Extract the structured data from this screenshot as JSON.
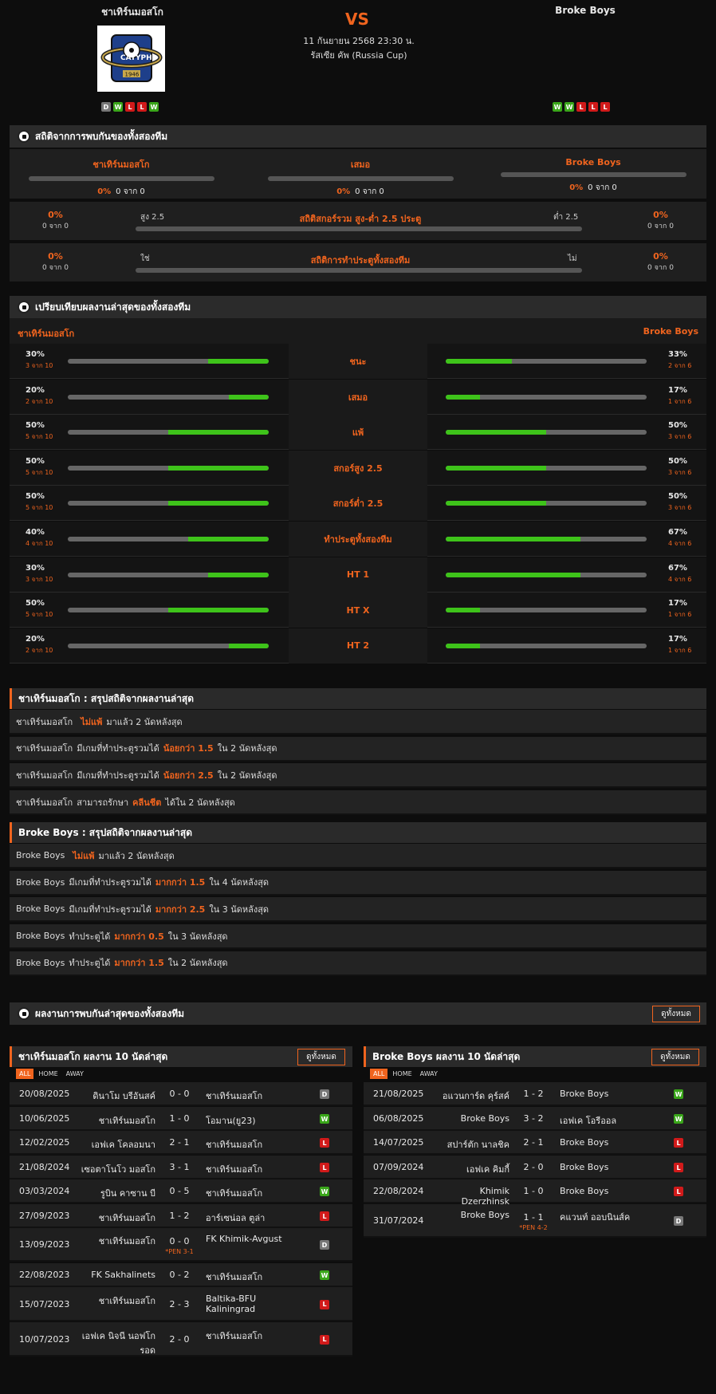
{
  "match": {
    "home": "ชาเทิร์นมอสโก",
    "away": "Broke Boys",
    "vs": "VS",
    "datetime": "11 กันยายน 2568 23:30 น.",
    "competition": "รัสเซีย คัพ (Russia Cup)",
    "logo_year": "1946",
    "home_form": [
      "D",
      "W",
      "L",
      "L",
      "W"
    ],
    "away_form": [
      "W",
      "W",
      "L",
      "L",
      "L"
    ]
  },
  "h2h": {
    "title": "สถิติจากการพบกันของทั้งสองทีม",
    "cols": [
      {
        "name": "ชาเทิร์นมอสโก",
        "pct": "0%",
        "sub": "0 จาก 0"
      },
      {
        "name": "เสมอ",
        "pct": "0%",
        "sub": "0 จาก 0"
      },
      {
        "name": "Broke Boys",
        "pct": "0%",
        "sub": "0 จาก 0"
      }
    ],
    "ou": {
      "left_pct": "0%",
      "left_sub": "0 จาก 0",
      "left_lbl": "สูง 2.5",
      "title": "สถิติสกอร์รวม สูง-ต่ำ 2.5 ประตู",
      "right_lbl": "ต่ำ 2.5",
      "right_pct": "0%",
      "right_sub": "0 จาก 0"
    },
    "btts": {
      "left_pct": "0%",
      "left_sub": "0 จาก 0",
      "left_lbl": "ใช่",
      "title": "สถิติการทำประตูทั้งสองทีม",
      "right_lbl": "ไม่",
      "right_pct": "0%",
      "right_sub": "0 จาก 0"
    }
  },
  "compare": {
    "title": "เปรียบเทียบผลงานล่าสุดของทั้งสองทีม",
    "home": "ชาเทิร์นมอสโก",
    "away": "Broke Boys",
    "rows": [
      {
        "label": "ชนะ",
        "lp": "30%",
        "ls": "3 จาก 10",
        "lv": 0.3,
        "rp": "33%",
        "rs": "2 จาก 6",
        "rv": 0.33
      },
      {
        "label": "เสมอ",
        "lp": "20%",
        "ls": "2 จาก 10",
        "lv": 0.2,
        "rp": "17%",
        "rs": "1 จาก 6",
        "rv": 0.17
      },
      {
        "label": "แพ้",
        "lp": "50%",
        "ls": "5 จาก 10",
        "lv": 0.5,
        "rp": "50%",
        "rs": "3 จาก 6",
        "rv": 0.5
      },
      {
        "label": "สกอร์สูง 2.5",
        "lp": "50%",
        "ls": "5 จาก 10",
        "lv": 0.5,
        "rp": "50%",
        "rs": "3 จาก 6",
        "rv": 0.5
      },
      {
        "label": "สกอร์ต่ำ 2.5",
        "lp": "50%",
        "ls": "5 จาก 10",
        "lv": 0.5,
        "rp": "50%",
        "rs": "3 จาก 6",
        "rv": 0.5
      },
      {
        "label": "ทำประตูทั้งสองทีม",
        "lp": "40%",
        "ls": "4 จาก 10",
        "lv": 0.4,
        "rp": "67%",
        "rs": "4 จาก 6",
        "rv": 0.67
      },
      {
        "label": "HT 1",
        "lp": "30%",
        "ls": "3 จาก 10",
        "lv": 0.3,
        "rp": "67%",
        "rs": "4 จาก 6",
        "rv": 0.67
      },
      {
        "label": "HT X",
        "lp": "50%",
        "ls": "5 จาก 10",
        "lv": 0.5,
        "rp": "17%",
        "rs": "1 จาก 6",
        "rv": 0.17
      },
      {
        "label": "HT 2",
        "lp": "20%",
        "ls": "2 จาก 10",
        "lv": 0.2,
        "rp": "17%",
        "rs": "1 จาก 6",
        "rv": 0.17
      }
    ]
  },
  "summary_home": {
    "title": "ชาเทิร์นมอสโก : สรุปสถิติจากผลงานล่าสุด",
    "rows": [
      {
        "team": "ชาเทิร์นมอสโก",
        "pre": "",
        "hl": "ไม่แพ้",
        "post": "มาแล้ว 2 นัดหลังสุด"
      },
      {
        "team": "ชาเทิร์นมอสโก",
        "pre": "มีเกมที่ทำประตูรวมได้",
        "hl": "น้อยกว่า 1.5",
        "post": "ใน 2 นัดหลังสุด"
      },
      {
        "team": "ชาเทิร์นมอสโก",
        "pre": "มีเกมที่ทำประตูรวมได้",
        "hl": "น้อยกว่า 2.5",
        "post": "ใน 2 นัดหลังสุด"
      },
      {
        "team": "ชาเทิร์นมอสโก",
        "pre": "สามารถรักษา",
        "hl": "คลีนชีต",
        "post": "ได้ใน 2 นัดหลังสุด"
      }
    ]
  },
  "summary_away": {
    "title": "Broke Boys : สรุปสถิติจากผลงานล่าสุด",
    "rows": [
      {
        "team": "Broke Boys",
        "pre": "",
        "hl": "ไม่แพ้",
        "post": "มาแล้ว 2 นัดหลังสุด"
      },
      {
        "team": "Broke Boys",
        "pre": "มีเกมที่ทำประตูรวมได้",
        "hl": "มากกว่า 1.5",
        "post": "ใน 4 นัดหลังสุด"
      },
      {
        "team": "Broke Boys",
        "pre": "มีเกมที่ทำประตูรวมได้",
        "hl": "มากกว่า 2.5",
        "post": "ใน 3 นัดหลังสุด"
      },
      {
        "team": "Broke Boys",
        "pre": "ทำประตูได้",
        "hl": "มากกว่า 0.5",
        "post": "ใน 3 นัดหลังสุด"
      },
      {
        "team": "Broke Boys",
        "pre": "ทำประตูได้",
        "hl": "มากกว่า 1.5",
        "post": "ใน 2 นัดหลังสุด"
      }
    ]
  },
  "recent": {
    "title": "ผลงานการพบกันล่าสุดของทั้งสองทีม",
    "view_all": "ดูทั้งหมด",
    "tabs": [
      "ALL",
      "HOME",
      "AWAY"
    ],
    "home_title": "ชาเทิร์นมอสโก ผลงาน 10 นัดล่าสุด",
    "away_title": "Broke Boys ผลงาน 10 นัดล่าสุด",
    "home_matches": [
      {
        "date": "20/08/2025",
        "home": "ดินาโม บรีอันสค์",
        "score": "0 - 0",
        "away": "ชาเทิร์นมอสโก",
        "res": "D"
      },
      {
        "date": "10/06/2025",
        "home": "ชาเทิร์นมอสโก",
        "score": "1 - 0",
        "away": "โอมาน(ยู23)",
        "res": "W"
      },
      {
        "date": "12/02/2025",
        "home": "เอฟเค โคลอมนา",
        "score": "2 - 1",
        "away": "ชาเทิร์นมอสโก",
        "res": "L"
      },
      {
        "date": "21/08/2024",
        "home": "เซอตาโนโว มอสโก",
        "score": "3 - 1",
        "away": "ชาเทิร์นมอสโก",
        "res": "L"
      },
      {
        "date": "03/03/2024",
        "home": "รูบิน คาซาน บี",
        "score": "0 - 5",
        "away": "ชาเทิร์นมอสโก",
        "res": "W"
      },
      {
        "date": "27/09/2023",
        "home": "ชาเทิร์นมอสโก",
        "score": "1 - 2",
        "away": "อาร์เซน่อล ตูล่า",
        "res": "L"
      },
      {
        "date": "13/09/2023",
        "home": "ชาเทิร์นมอสโก",
        "score": "0 - 0",
        "pen": "*PEN 3-1",
        "away": "FK Khimik-Avgust",
        "res": "D"
      },
      {
        "date": "22/08/2023",
        "home": "FK Sakhalinets",
        "score": "0 - 2",
        "away": "ชาเทิร์นมอสโก",
        "res": "W"
      },
      {
        "date": "15/07/2023",
        "home": "ชาเทิร์นมอสโก",
        "score": "2 - 3",
        "away": "Baltika-BFU Kaliningrad",
        "res": "L"
      },
      {
        "date": "10/07/2023",
        "home": "เอฟเค นิจนี นอฟโกรอด",
        "score": "2 - 0",
        "away": "ชาเทิร์นมอสโก",
        "res": "L"
      }
    ],
    "away_matches": [
      {
        "date": "21/08/2025",
        "home": "อแวนการ์ด คุร์สค์",
        "score": "1 - 2",
        "away": "Broke Boys",
        "res": "W"
      },
      {
        "date": "06/08/2025",
        "home": "Broke Boys",
        "score": "3 - 2",
        "away": "เอฟเค โอรีออล",
        "res": "W"
      },
      {
        "date": "14/07/2025",
        "home": "สปาร์ตัก นาลชิค",
        "score": "2 - 1",
        "away": "Broke Boys",
        "res": "L"
      },
      {
        "date": "07/09/2024",
        "home": "เอฟเค คิมกี้",
        "score": "2 - 0",
        "away": "Broke Boys",
        "res": "L"
      },
      {
        "date": "22/08/2024",
        "home": "Khimik Dzerzhinsk",
        "score": "1 - 0",
        "away": "Broke Boys",
        "res": "L"
      },
      {
        "date": "31/07/2024",
        "home": "Broke Boys",
        "score": "1 - 1",
        "pen": "*PEN 4-2",
        "away": "คแวนท์ ออบนินส์ค",
        "res": "D"
      }
    ]
  }
}
